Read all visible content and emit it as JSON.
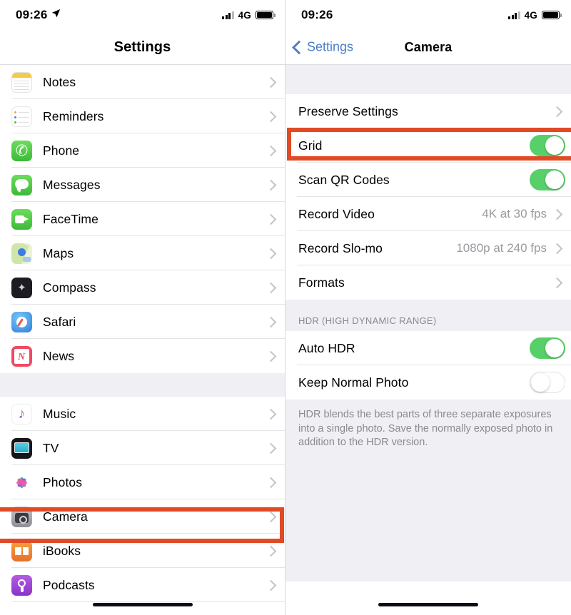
{
  "colors": {
    "highlight": "#e04a24",
    "toggle_on": "#58d06a",
    "link_blue": "#4a80c8",
    "group_bg": "#efeff4",
    "value_gray": "#9a9aa0"
  },
  "left": {
    "status": {
      "time": "09:26",
      "location_icon": "location-arrow-icon",
      "signal_icon": "signal-bars-icon",
      "network": "4G",
      "battery_icon": "battery-icon"
    },
    "nav": {
      "title": "Settings"
    },
    "groups": [
      {
        "rows": [
          {
            "label": "Notes",
            "icon": "notes-icon",
            "accessory": "chevron"
          },
          {
            "label": "Reminders",
            "icon": "reminders-icon",
            "accessory": "chevron"
          },
          {
            "label": "Phone",
            "icon": "phone-icon",
            "accessory": "chevron"
          },
          {
            "label": "Messages",
            "icon": "messages-icon",
            "accessory": "chevron"
          },
          {
            "label": "FaceTime",
            "icon": "facetime-icon",
            "accessory": "chevron"
          },
          {
            "label": "Maps",
            "icon": "maps-icon",
            "accessory": "chevron"
          },
          {
            "label": "Compass",
            "icon": "compass-icon",
            "accessory": "chevron"
          },
          {
            "label": "Safari",
            "icon": "safari-icon",
            "accessory": "chevron"
          },
          {
            "label": "News",
            "icon": "news-icon",
            "accessory": "chevron"
          }
        ]
      },
      {
        "rows": [
          {
            "label": "Music",
            "icon": "music-icon",
            "accessory": "chevron"
          },
          {
            "label": "TV",
            "icon": "tv-icon",
            "accessory": "chevron"
          },
          {
            "label": "Photos",
            "icon": "photos-icon",
            "accessory": "chevron"
          },
          {
            "label": "Camera",
            "icon": "camera-icon",
            "accessory": "chevron",
            "highlighted": true
          },
          {
            "label": "iBooks",
            "icon": "ibooks-icon",
            "accessory": "chevron"
          },
          {
            "label": "Podcasts",
            "icon": "podcasts-icon",
            "accessory": "chevron"
          }
        ]
      }
    ]
  },
  "right": {
    "status": {
      "time": "09:26",
      "signal_icon": "signal-bars-icon",
      "network": "4G",
      "battery_icon": "battery-icon"
    },
    "nav": {
      "back_label": "Settings",
      "title": "Camera"
    },
    "group1": {
      "rows": [
        {
          "label": "Preserve Settings",
          "accessory": "chevron"
        },
        {
          "label": "Grid",
          "accessory": "toggle",
          "toggle": "on",
          "highlighted": true
        },
        {
          "label": "Scan QR Codes",
          "accessory": "toggle",
          "toggle": "on"
        },
        {
          "label": "Record Video",
          "accessory": "chevron",
          "value": "4K at 30 fps"
        },
        {
          "label": "Record Slo-mo",
          "accessory": "chevron",
          "value": "1080p at 240 fps"
        },
        {
          "label": "Formats",
          "accessory": "chevron"
        }
      ]
    },
    "hdr_section": {
      "header": "HDR (HIGH DYNAMIC RANGE)",
      "rows": [
        {
          "label": "Auto HDR",
          "accessory": "toggle",
          "toggle": "on"
        },
        {
          "label": "Keep Normal Photo",
          "accessory": "toggle",
          "toggle": "off"
        }
      ],
      "footer": "HDR blends the best parts of three separate exposures into a single photo. Save the normally exposed photo in addition to the HDR version."
    }
  }
}
